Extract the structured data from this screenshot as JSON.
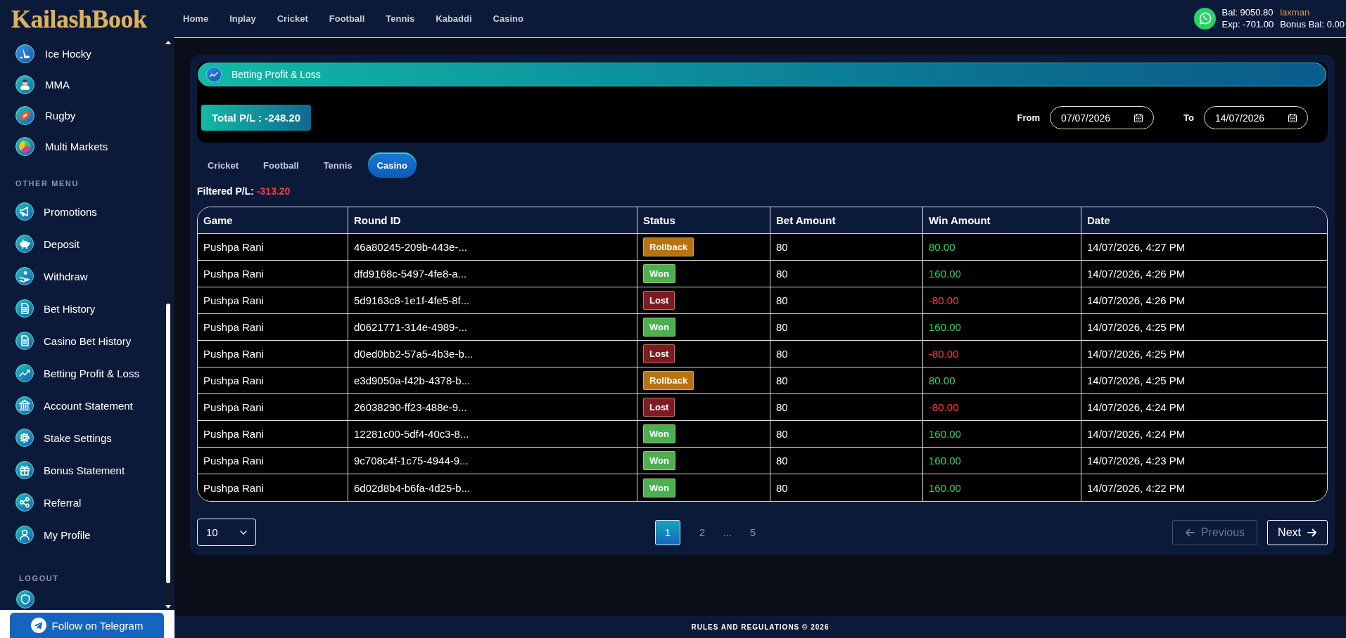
{
  "header": {
    "logo": "KailashBook",
    "nav": [
      {
        "label": "Home"
      },
      {
        "label": "Inplay"
      },
      {
        "label": "Cricket"
      },
      {
        "label": "Football"
      },
      {
        "label": "Tennis"
      },
      {
        "label": "Kabaddi"
      },
      {
        "label": "Casino"
      }
    ],
    "account": {
      "balance": "Bal: 9050.80",
      "username": "laxman",
      "exposure": "Exp: -701.00",
      "bonus_balance": "Bonus Bal: 0.00"
    }
  },
  "sidebar": {
    "sports": [
      {
        "label": "Ice Hocky"
      },
      {
        "label": "MMA"
      },
      {
        "label": "Rugby"
      },
      {
        "label": "Multi Markets"
      }
    ],
    "other_menu": {
      "title": "OTHER MENU",
      "items": [
        {
          "label": "Promotions"
        },
        {
          "label": "Deposit"
        },
        {
          "label": "Withdraw"
        },
        {
          "label": "Bet History"
        },
        {
          "label": "Casino Bet History"
        },
        {
          "label": "Betting Profit & Loss"
        },
        {
          "label": "Account Statement"
        },
        {
          "label": "Stake Settings"
        },
        {
          "label": "Bonus Statement"
        },
        {
          "label": "Referral"
        },
        {
          "label": "My Profile"
        }
      ]
    },
    "logout": {
      "title": "LOGOUT"
    },
    "telegram_button": "Follow on Telegram"
  },
  "page": {
    "title": "Betting Profit & Loss",
    "total_pl": "Total P/L : -248.20",
    "date_range": {
      "from_label": "From",
      "from": "07/07/2026",
      "to_label": "To",
      "to": "14/07/2026"
    },
    "tabs": [
      {
        "label": "Cricket",
        "selected": false
      },
      {
        "label": "Football",
        "selected": false
      },
      {
        "label": "Tennis",
        "selected": false
      },
      {
        "label": "Casino",
        "selected": true
      }
    ],
    "filtered_pl": {
      "label": "Filtered P/L:",
      "value": "-313.20"
    },
    "table": {
      "columns": [
        "Game",
        "Round ID",
        "Status",
        "Bet Amount",
        "Win Amount",
        "Date"
      ],
      "rows": [
        {
          "game": "Pushpa Rani",
          "round_id": "46a80245-209b-443e-...",
          "status": {
            "label": "Rollback",
            "color": "#b8730f"
          },
          "bet_amount": "80",
          "win_amount": {
            "text": "80.00",
            "color": "#2fd35a"
          },
          "date": "14/07/2026, 4:27 PM"
        },
        {
          "game": "Pushpa Rani",
          "round_id": "dfd9168c-5497-4fe8-a...",
          "status": {
            "label": "Won",
            "color": "#4caf50"
          },
          "bet_amount": "80",
          "win_amount": {
            "text": "160.00",
            "color": "#2fd35a"
          },
          "date": "14/07/2026, 4:26 PM"
        },
        {
          "game": "Pushpa Rani",
          "round_id": "5d9163c8-1e1f-4fe5-8f...",
          "status": {
            "label": "Lost",
            "color": "#7d1a22"
          },
          "bet_amount": "80",
          "win_amount": {
            "text": "-80.00",
            "color": "#ff3b3b"
          },
          "date": "14/07/2026, 4:26 PM"
        },
        {
          "game": "Pushpa Rani",
          "round_id": "d0621771-314e-4989-...",
          "status": {
            "label": "Won",
            "color": "#4caf50"
          },
          "bet_amount": "80",
          "win_amount": {
            "text": "160.00",
            "color": "#2fd35a"
          },
          "date": "14/07/2026, 4:25 PM"
        },
        {
          "game": "Pushpa Rani",
          "round_id": "d0ed0bb2-57a5-4b3e-b...",
          "status": {
            "label": "Lost",
            "color": "#7d1a22"
          },
          "bet_amount": "80",
          "win_amount": {
            "text": "-80.00",
            "color": "#ff3b3b"
          },
          "date": "14/07/2026, 4:25 PM"
        },
        {
          "game": "Pushpa Rani",
          "round_id": "e3d9050a-f42b-4378-b...",
          "status": {
            "label": "Rollback",
            "color": "#b8730f"
          },
          "bet_amount": "80",
          "win_amount": {
            "text": "80.00",
            "color": "#2fd35a"
          },
          "date": "14/07/2026, 4:25 PM"
        },
        {
          "game": "Pushpa Rani",
          "round_id": "26038290-ff23-488e-9...",
          "status": {
            "label": "Lost",
            "color": "#7d1a22"
          },
          "bet_amount": "80",
          "win_amount": {
            "text": "-80.00",
            "color": "#ff3b3b"
          },
          "date": "14/07/2026, 4:24 PM"
        },
        {
          "game": "Pushpa Rani",
          "round_id": "12281c00-5df4-40c3-8...",
          "status": {
            "label": "Won",
            "color": "#4caf50"
          },
          "bet_amount": "80",
          "win_amount": {
            "text": "160.00",
            "color": "#2fd35a"
          },
          "date": "14/07/2026, 4:24 PM"
        },
        {
          "game": "Pushpa Rani",
          "round_id": "9c708c4f-1c75-4944-9...",
          "status": {
            "label": "Won",
            "color": "#4caf50"
          },
          "bet_amount": "80",
          "win_amount": {
            "text": "160.00",
            "color": "#2fd35a"
          },
          "date": "14/07/2026, 4:23 PM"
        },
        {
          "game": "Pushpa Rani",
          "round_id": "6d02d8b4-b6fa-4d25-b...",
          "status": {
            "label": "Won",
            "color": "#4caf50"
          },
          "bet_amount": "80",
          "win_amount": {
            "text": "160.00",
            "color": "#2fd35a"
          },
          "date": "14/07/2026, 4:22 PM"
        }
      ]
    },
    "pagination": {
      "page_size": "10",
      "pages": [
        {
          "kind": "page",
          "label": "1",
          "selected": true
        },
        {
          "kind": "page",
          "label": "2",
          "selected": false
        },
        {
          "kind": "gap",
          "label": "..."
        },
        {
          "kind": "page",
          "label": "5",
          "selected": false
        }
      ],
      "previous": {
        "label": "Previous",
        "disabled": true
      },
      "next": {
        "label": "Next",
        "disabled": false
      }
    }
  },
  "footer": "RULES AND REGULATIONS © 2026"
}
